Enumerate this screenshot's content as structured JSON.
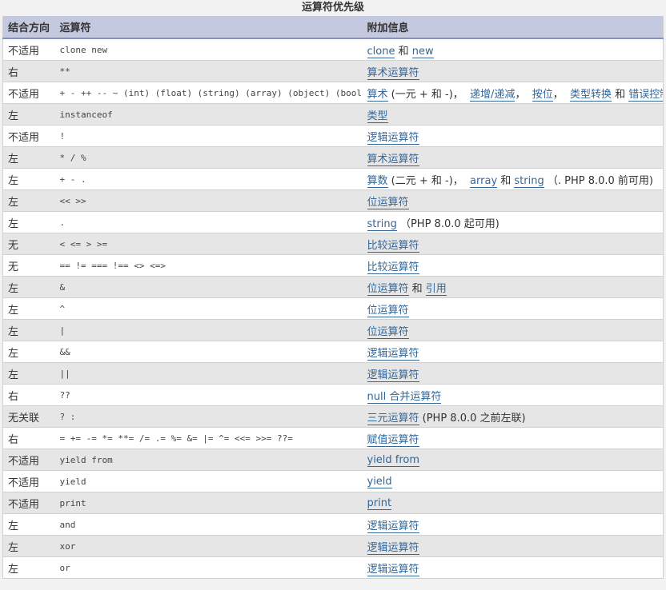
{
  "caption": "运算符优先级",
  "headers": {
    "assoc": "结合方向",
    "op": "运算符",
    "info": "附加信息"
  },
  "colors": {
    "header_bg": "#c4c9df",
    "header_border": "#8892bf",
    "link": "#336699",
    "row_alt": "#e6e6e6"
  },
  "rows": [
    {
      "assoc": "不适用",
      "op": "clone new",
      "info": [
        {
          "t": "clone",
          "link": true
        },
        {
          "t": " 和 "
        },
        {
          "t": "new",
          "link": true
        }
      ]
    },
    {
      "assoc": "右",
      "op": "**",
      "info": [
        {
          "t": "算术运算符",
          "link": true
        }
      ]
    },
    {
      "assoc": "不适用",
      "op": "+ - ++ -- ~ (int) (float) (string) (array) (object) (bool) @",
      "info": [
        {
          "t": "算术",
          "link": true
        },
        {
          "t": " (一元 + 和 -)，  "
        },
        {
          "t": "递增/递减",
          "link": true
        },
        {
          "t": "，  "
        },
        {
          "t": "按位",
          "link": true
        },
        {
          "t": "，  "
        },
        {
          "t": "类型转换",
          "link": true
        },
        {
          "t": " 和 "
        },
        {
          "t": "错误控制",
          "link": true
        }
      ]
    },
    {
      "assoc": "左",
      "op": "instanceof",
      "info": [
        {
          "t": "类型",
          "link": true
        }
      ]
    },
    {
      "assoc": "不适用",
      "op": "!",
      "info": [
        {
          "t": "逻辑运算符",
          "link": true
        }
      ]
    },
    {
      "assoc": "左",
      "op": "* / %",
      "info": [
        {
          "t": "算术运算符",
          "link": true
        }
      ]
    },
    {
      "assoc": "左",
      "op": "+ - .",
      "info": [
        {
          "t": "算数",
          "link": true
        },
        {
          "t": " (二元 + 和 -)，  "
        },
        {
          "t": "array",
          "link": true
        },
        {
          "t": " 和 "
        },
        {
          "t": "string",
          "link": true
        },
        {
          "t": " （. PHP 8.0.0 前可用)"
        }
      ]
    },
    {
      "assoc": "左",
      "op": "<< >>",
      "info": [
        {
          "t": "位运算符",
          "link": true
        }
      ]
    },
    {
      "assoc": "左",
      "op": ".",
      "info": [
        {
          "t": "string",
          "link": true
        },
        {
          "t": " （PHP 8.0.0 起可用)"
        }
      ]
    },
    {
      "assoc": "无",
      "op": "< <= > >=",
      "info": [
        {
          "t": "比较运算符",
          "link": true
        }
      ]
    },
    {
      "assoc": "无",
      "op": "== != === !== <> <=>",
      "info": [
        {
          "t": "比较运算符",
          "link": true
        }
      ]
    },
    {
      "assoc": "左",
      "op": "&",
      "info": [
        {
          "t": "位运算符",
          "link": true
        },
        {
          "t": " 和 "
        },
        {
          "t": "引用",
          "link": true
        }
      ]
    },
    {
      "assoc": "左",
      "op": "^",
      "info": [
        {
          "t": "位运算符",
          "link": true
        }
      ]
    },
    {
      "assoc": "左",
      "op": "|",
      "info": [
        {
          "t": "位运算符",
          "link": true
        }
      ]
    },
    {
      "assoc": "左",
      "op": "&&",
      "info": [
        {
          "t": "逻辑运算符",
          "link": true
        }
      ]
    },
    {
      "assoc": "左",
      "op": "||",
      "info": [
        {
          "t": "逻辑运算符",
          "link": true
        }
      ]
    },
    {
      "assoc": "右",
      "op": "??",
      "info": [
        {
          "t": "null 合并运算符",
          "link": true
        }
      ]
    },
    {
      "assoc": "无关联",
      "op": "? :",
      "info": [
        {
          "t": "三元运算符",
          "link": true
        },
        {
          "t": " (PHP 8.0.0 之前左联)"
        }
      ]
    },
    {
      "assoc": "右",
      "op": "= += -= *= **= /= .= %= &= |= ^= <<= >>= ??=",
      "info": [
        {
          "t": "赋值运算符",
          "link": true
        }
      ]
    },
    {
      "assoc": "不适用",
      "op": "yield from",
      "info": [
        {
          "t": "yield from",
          "link": true
        }
      ]
    },
    {
      "assoc": "不适用",
      "op": "yield",
      "info": [
        {
          "t": "yield",
          "link": true
        }
      ]
    },
    {
      "assoc": "不适用",
      "op": "print",
      "info": [
        {
          "t": "print",
          "link": true
        }
      ]
    },
    {
      "assoc": "左",
      "op": "and",
      "info": [
        {
          "t": "逻辑运算符",
          "link": true
        }
      ]
    },
    {
      "assoc": "左",
      "op": "xor",
      "info": [
        {
          "t": "逻辑运算符",
          "link": true
        }
      ]
    },
    {
      "assoc": "左",
      "op": "or",
      "info": [
        {
          "t": "逻辑运算符",
          "link": true
        }
      ]
    }
  ]
}
